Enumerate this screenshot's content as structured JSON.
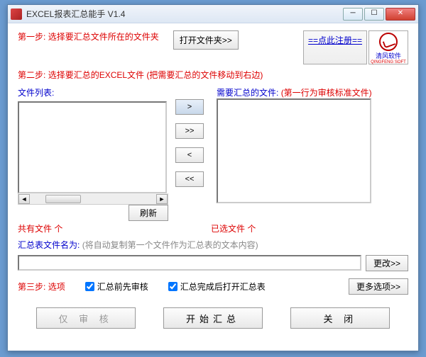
{
  "title": "EXCEL报表汇总能手 V1.4",
  "step1": {
    "label": "第一步:",
    "text": "选择要汇总文件所在的文件夹",
    "button": "打开文件夹>>"
  },
  "register": {
    "link": "==点此注册=="
  },
  "logo": {
    "name": "清风软件",
    "en": "QINGFENG SOFT"
  },
  "step2": {
    "label": "第二步:",
    "text": "选择要汇总的EXCEL文件 (把需要汇总的文件移动到右边)"
  },
  "leftList": {
    "label": "文件列表:",
    "count": "共有文件  个",
    "refresh": "刷新"
  },
  "rightList": {
    "label": "需要汇总的文件:",
    "extra": "(第一行为审核标准文件)",
    "count": "已选文件  个"
  },
  "move": {
    "one_right": ">",
    "all_right": ">>",
    "one_left": "<",
    "all_left": "<<"
  },
  "copyNote": {
    "prefix": "汇总表文件名为:",
    "gray": "(将自动复制第一个文件作为汇总表的文本内容)"
  },
  "filename": {
    "value": "",
    "changeBtn": "更改>>"
  },
  "step3": {
    "label": "第三步:",
    "opt": "选项",
    "chk1": "汇总前先审核",
    "chk2": "汇总完成后打开汇总表",
    "moreBtn": "更多选项>>"
  },
  "bottom": {
    "audit": "仅 审 核",
    "start": "开始汇总",
    "close": "关    闭"
  }
}
